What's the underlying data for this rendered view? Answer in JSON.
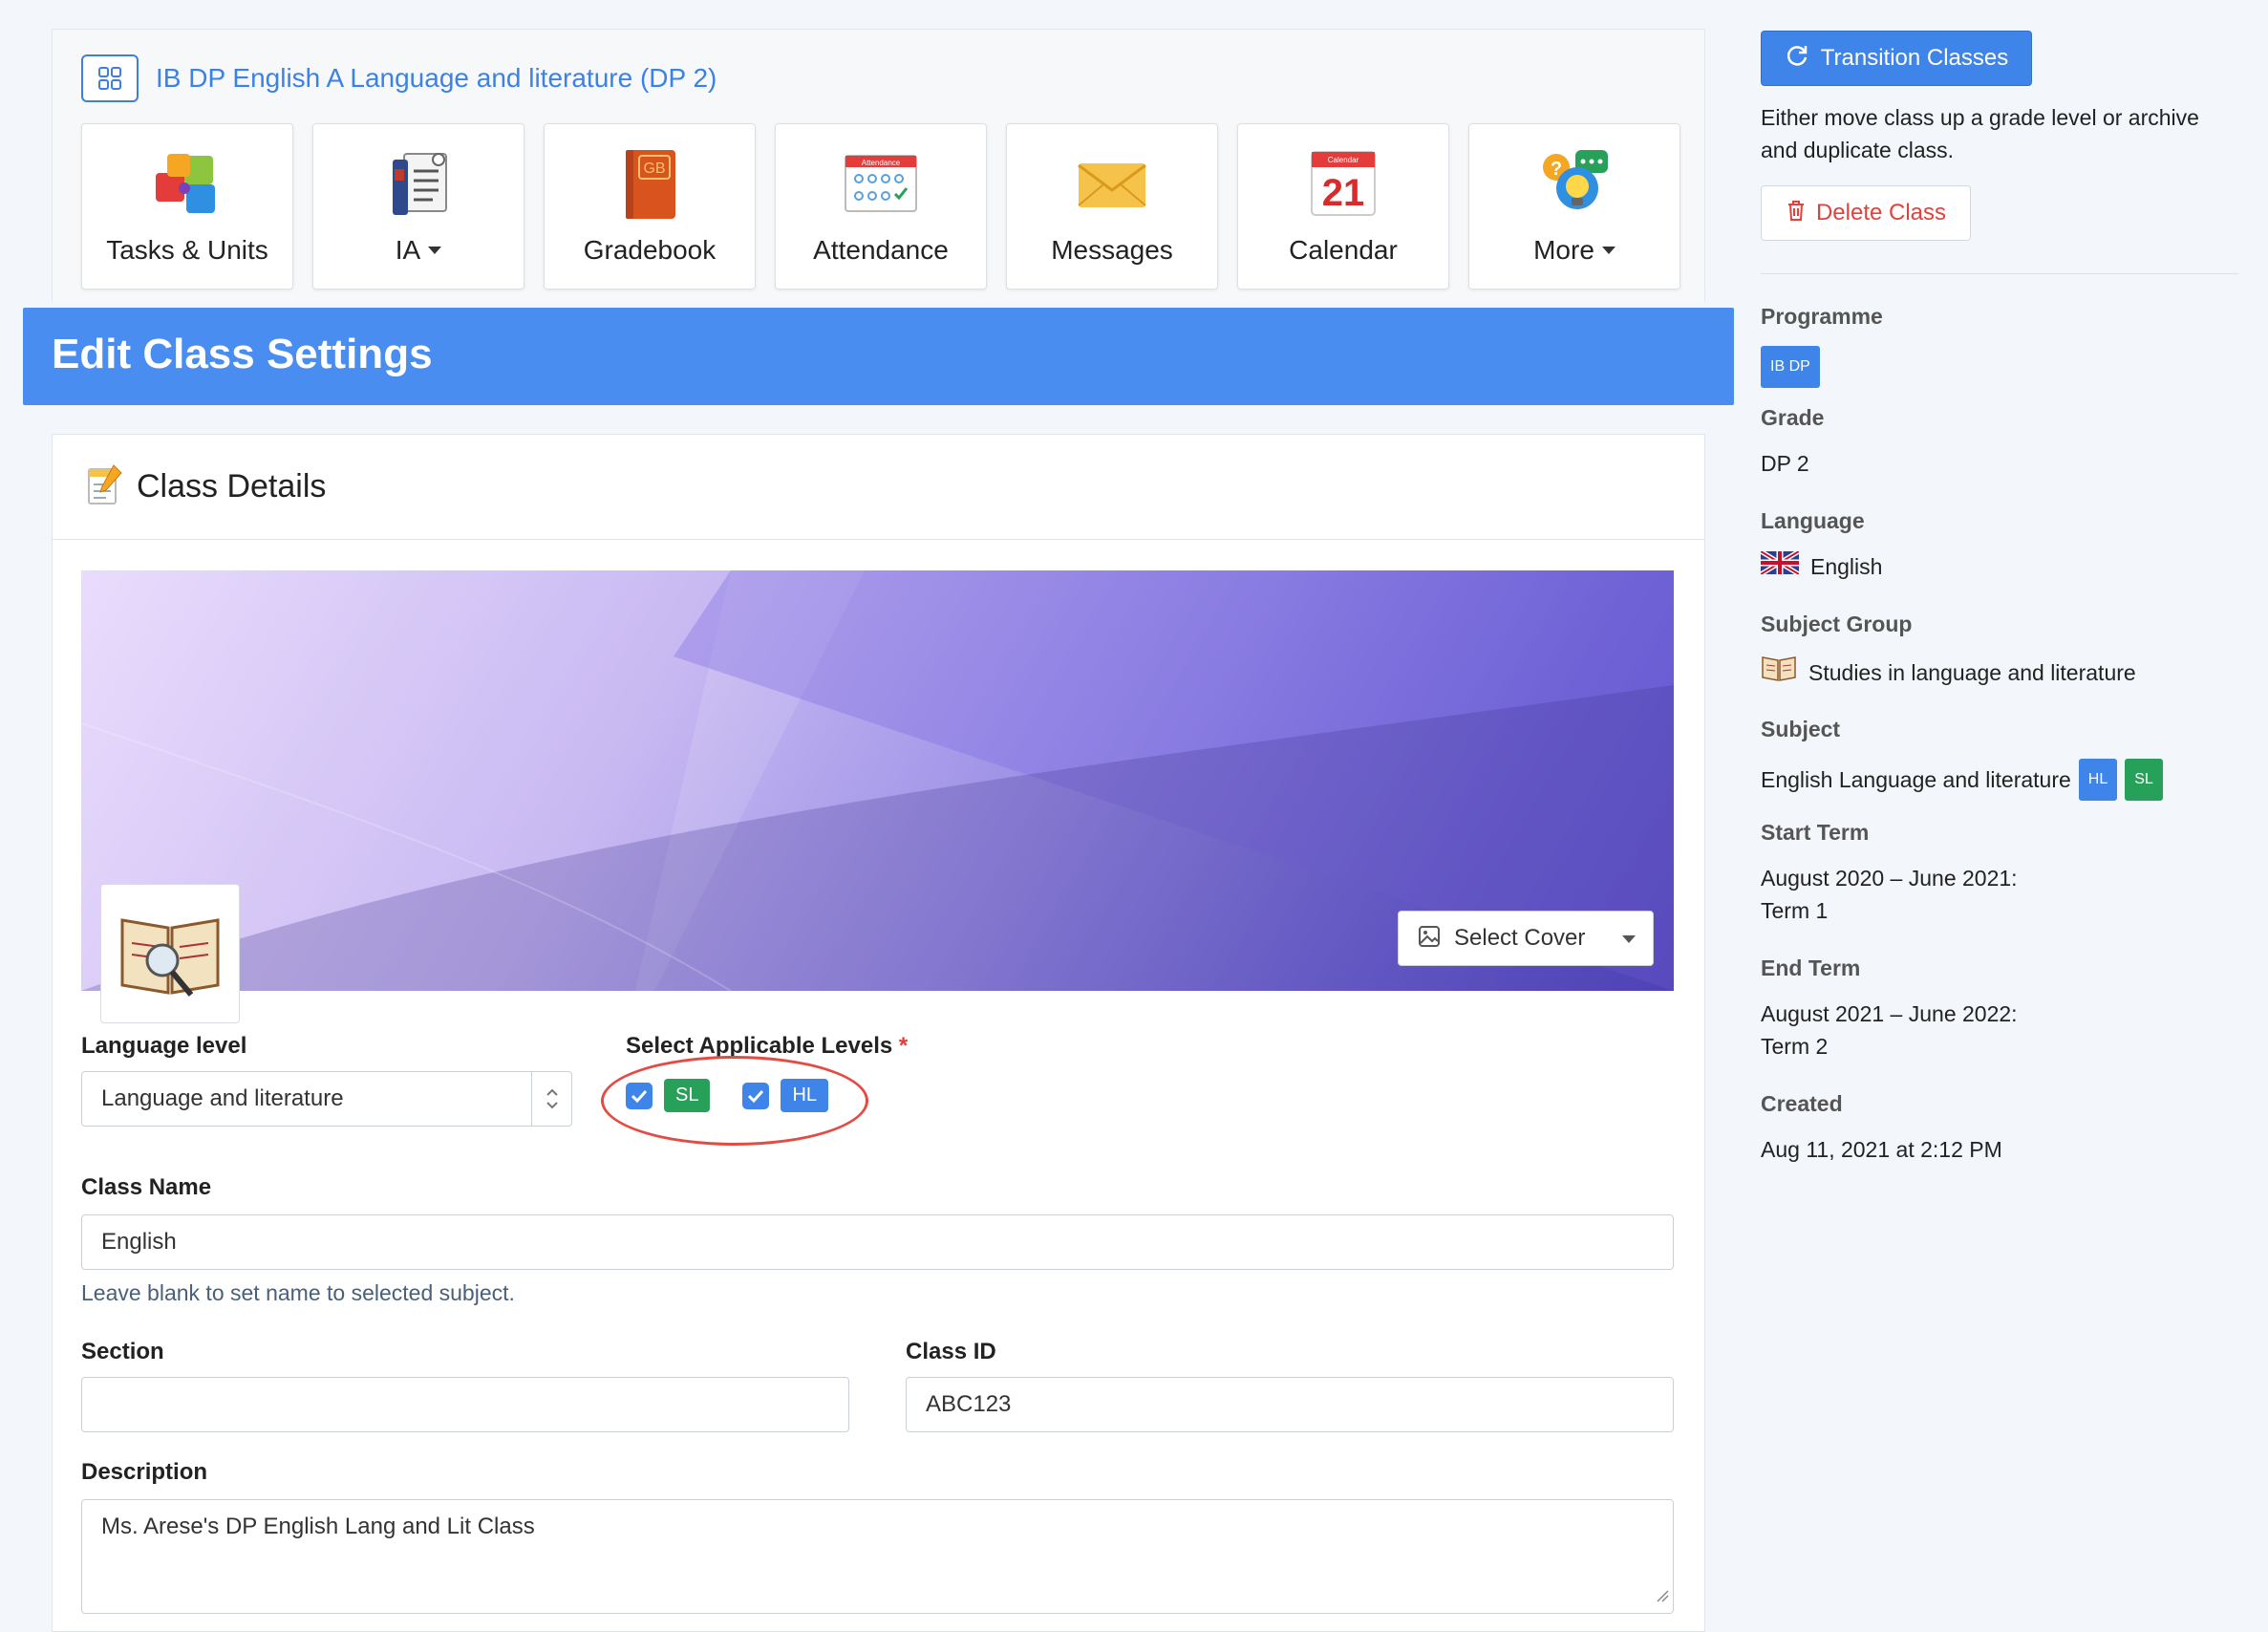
{
  "class_header": {
    "title": "IB DP English A Language and literature (DP 2)",
    "grid_icon": "grid-icon"
  },
  "tiles": [
    {
      "label": "Tasks & Units",
      "icon": "puzzle-icon",
      "dropdown": false
    },
    {
      "label": "IA",
      "icon": "ia-document-icon",
      "dropdown": true
    },
    {
      "label": "Gradebook",
      "icon": "gradebook-icon",
      "dropdown": false
    },
    {
      "label": "Attendance",
      "icon": "attendance-icon",
      "dropdown": false
    },
    {
      "label": "Messages",
      "icon": "envelope-icon",
      "dropdown": false
    },
    {
      "label": "Calendar",
      "icon": "calendar-icon",
      "dropdown": false
    },
    {
      "label": "More",
      "icon": "more-bulb-icon",
      "dropdown": true
    }
  ],
  "tile_icon_text": {
    "gradebook": "GB",
    "attendance": "Attendance",
    "calendar_top": "Calendar",
    "calendar_day": "21"
  },
  "page_title": "Edit Class Settings",
  "details": {
    "title": "Class Details",
    "select_cover": "Select Cover",
    "language_level": {
      "label": "Language level",
      "value": "Language and literature"
    },
    "levels": {
      "label": "Select Applicable Levels",
      "required_mark": "*",
      "options": [
        "SL",
        "HL"
      ]
    },
    "class_name": {
      "label": "Class Name",
      "value": "English",
      "help": "Leave blank to set name to selected subject."
    },
    "section": {
      "label": "Section",
      "value": ""
    },
    "class_id": {
      "label": "Class ID",
      "value": "ABC123"
    },
    "description": {
      "label": "Description",
      "value": "Ms. Arese's DP English Lang and Lit Class"
    }
  },
  "sidebar": {
    "transition_button": "Transition Classes",
    "transition_desc": "Either move class up a grade level or archive and duplicate class.",
    "delete_button": "Delete Class",
    "programme": {
      "label": "Programme",
      "value": "IB DP"
    },
    "grade": {
      "label": "Grade",
      "value": "DP 2"
    },
    "language": {
      "label": "Language",
      "value": "English",
      "icon": "uk-flag-icon"
    },
    "subject_group": {
      "label": "Subject Group",
      "value": "Studies in language and literature",
      "icon": "book-icon"
    },
    "subject": {
      "label": "Subject",
      "value": "English Language and literature",
      "badges": [
        "HL",
        "SL"
      ]
    },
    "start_term": {
      "label": "Start Term",
      "line1": "August 2020 – June 2021:",
      "line2": "Term 1"
    },
    "end_term": {
      "label": "End Term",
      "line1": "August 2021 – June 2022:",
      "line2": "Term 2"
    },
    "created": {
      "label": "Created",
      "value": "Aug 11, 2021 at 2:12 PM"
    }
  },
  "colors": {
    "accent": "#3f84e8",
    "banner": "#4a8df0",
    "sl_green": "#27a15a",
    "hl_blue": "#3f84e8",
    "danger": "#e0423c"
  }
}
